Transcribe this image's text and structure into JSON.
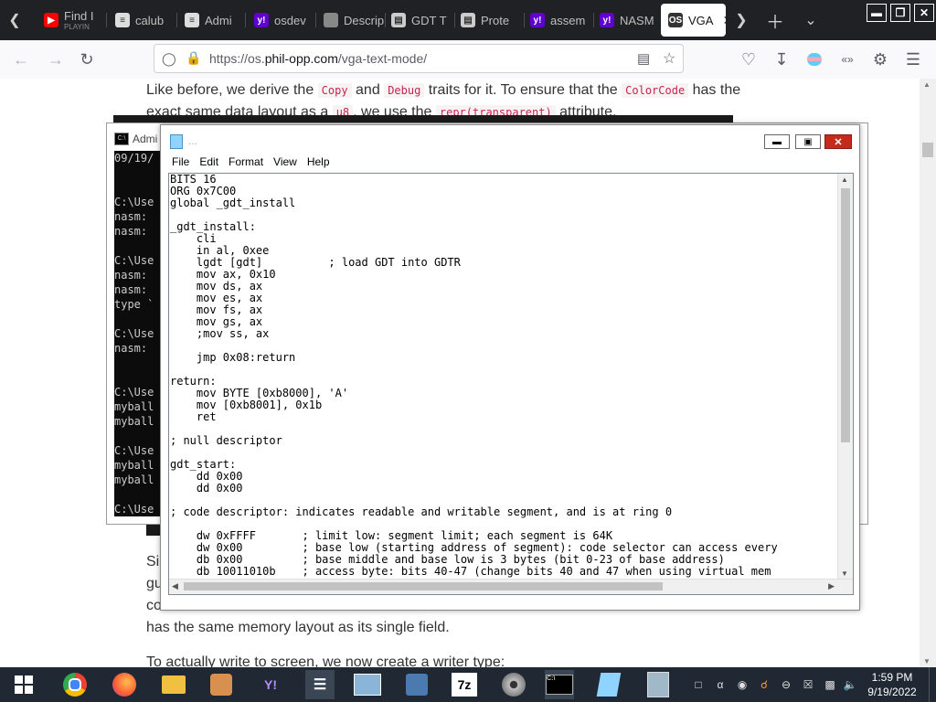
{
  "browser": {
    "tabs": [
      {
        "label": "Find I",
        "sublabel": "PLAYIN",
        "icon": "youtube-icon"
      },
      {
        "label": "calub",
        "icon": "doc-icon"
      },
      {
        "label": "Admi",
        "icon": "doc-icon"
      },
      {
        "label": "osdev",
        "icon": "yahoo-icon"
      },
      {
        "label": "Descriptor",
        "icon": "page-icon"
      },
      {
        "label": "GDT T",
        "icon": "page-icon"
      },
      {
        "label": "Prote",
        "icon": "page-icon"
      },
      {
        "label": "assem",
        "icon": "yahoo-icon"
      },
      {
        "label": "NASM",
        "icon": "yahoo-icon"
      },
      {
        "label": "VGA",
        "icon": "os-icon",
        "active": true
      }
    ],
    "url_host": "https://os.",
    "url_domain": "phil-opp.com",
    "url_path": "/vga-text-mode/"
  },
  "page": {
    "p1_a": "Like before, we derive the",
    "p1_code1": "Copy",
    "p1_b": "and",
    "p1_code2": "Debug",
    "p1_c": "traits for it. To ensure that the",
    "p1_code3": "ColorCode",
    "p1_d": "has the",
    "p2_a": "exact same data layout as a",
    "p2_code1": "u8",
    "p2_b": ", we use the",
    "p2_code2": "repr(transparent)",
    "p2_c": "attribute.",
    "left1": "Si",
    "left2": "gu",
    "left3": "co",
    "p_mid_tail": "has the same memory layout as its single field.",
    "p_last": "To actually write to screen, we now create a writer type:"
  },
  "cmd": {
    "title": "Admi",
    "lines": [
      "09/19/",
      "",
      "",
      "C:\\Use",
      "nasm:",
      "nasm:",
      "",
      "C:\\Use",
      "nasm:",
      "nasm:",
      "type `",
      "",
      "C:\\Use",
      "nasm:",
      "",
      "",
      "C:\\Use",
      "myball",
      "myball",
      "",
      "C:\\Use",
      "myball",
      "myball",
      "",
      "C:\\Use"
    ]
  },
  "notepad": {
    "title": "...",
    "menu": [
      "File",
      "Edit",
      "Format",
      "View",
      "Help"
    ],
    "code": "BITS 16\nORG 0x7C00\nglobal _gdt_install\n\n_gdt_install:\n    cli\n    in al, 0xee\n    lgdt [gdt]          ; load GDT into GDTR\n    mov ax, 0x10\n    mov ds, ax\n    mov es, ax\n    mov fs, ax\n    mov gs, ax\n    ;mov ss, ax\n\n    jmp 0x08:return\n\nreturn:\n    mov BYTE [0xb8000], 'A'\n    mov [0xb8001], 0x1b\n    ret\n\n; null descriptor\n\ngdt_start:\n    dd 0x00\n    dd 0x00\n\n; code descriptor: indicates readable and writable segment, and is at ring 0\n\n    dw 0xFFFF       ; limit low: segment limit; each segment is 64K\n    dw 0x00         ; base low (starting address of segment): code selector can access every\n    db 0x00         ; base middle and base low is 3 bytes (bit 0-23 of base address)\n    db 10011010b    ; access byte: bits 40-47 (change bits 40 and 47 when using virtual mem"
  },
  "taskbar": {
    "apps": [
      "start-icon",
      "chrome-icon",
      "firefox-icon",
      "folder-icon",
      "paint-icon",
      "yahoo-icon",
      "mixer-icon",
      "monitor-icon",
      "network-icon",
      "7zip-icon",
      "dvd-icon",
      "cmd-icon",
      "notepad-icon",
      "calculator-icon"
    ],
    "seven_zip_label": "7z",
    "time": "1:59 PM",
    "date": "9/19/2022"
  }
}
